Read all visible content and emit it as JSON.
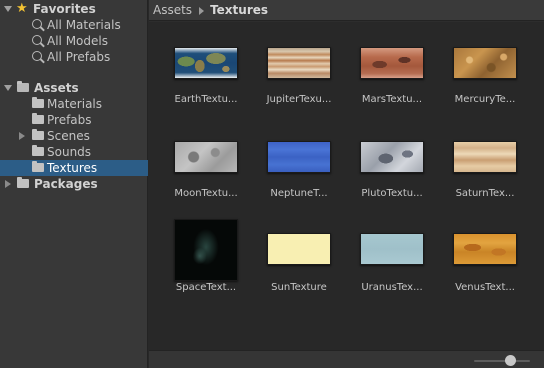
{
  "sidebar": {
    "favorites": {
      "label": "Favorites",
      "items": [
        {
          "label": "All Materials"
        },
        {
          "label": "All Models"
        },
        {
          "label": "All Prefabs"
        }
      ]
    },
    "assets": {
      "label": "Assets",
      "folders": [
        {
          "label": "Materials"
        },
        {
          "label": "Prefabs"
        },
        {
          "label": "Scenes"
        },
        {
          "label": "Sounds"
        },
        {
          "label": "Textures"
        }
      ]
    },
    "packages": {
      "label": "Packages"
    }
  },
  "breadcrumb": {
    "root": "Assets",
    "current": "Textures"
  },
  "textures": [
    {
      "label": "EarthTextu...",
      "icon": "earth-texture-thumbnail"
    },
    {
      "label": "JupiterTexu...",
      "icon": "jupiter-texture-thumbnail"
    },
    {
      "label": "MarsTextu...",
      "icon": "mars-texture-thumbnail"
    },
    {
      "label": "MercuryTe...",
      "icon": "mercury-texture-thumbnail"
    },
    {
      "label": "MoonTextu...",
      "icon": "moon-texture-thumbnail"
    },
    {
      "label": "NeptuneT...",
      "icon": "neptune-texture-thumbnail"
    },
    {
      "label": "PlutoTextu...",
      "icon": "pluto-texture-thumbnail"
    },
    {
      "label": "SaturnTex...",
      "icon": "saturn-texture-thumbnail"
    },
    {
      "label": "SpaceText...",
      "icon": "space-texture-thumbnail"
    },
    {
      "label": "SunTexture",
      "icon": "sun-texture-thumbnail"
    },
    {
      "label": "UranusTex...",
      "icon": "uranus-texture-thumbnail"
    },
    {
      "label": "VenusText...",
      "icon": "venus-texture-thumbnail"
    }
  ],
  "colors": {
    "selection": "#2c5d87",
    "star": "#f2c233"
  }
}
